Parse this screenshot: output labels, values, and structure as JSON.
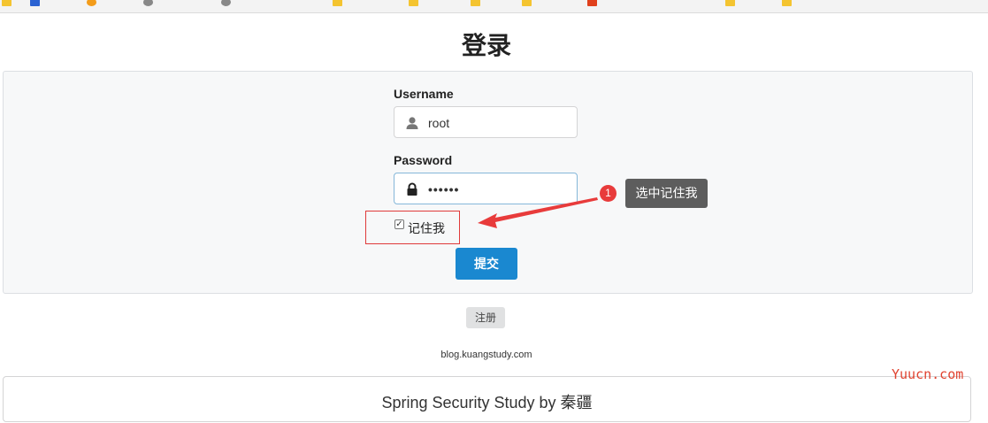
{
  "page_title": "登录",
  "form": {
    "username_label": "Username",
    "username_value": "root",
    "password_label": "Password",
    "password_value": "••••••",
    "remember_label": "记住我",
    "remember_checked": true,
    "submit_label": "提交"
  },
  "register_label": "注册",
  "blog_text": "blog.kuangstudy.com",
  "footer_text": "Spring Security Study by 秦疆",
  "annotation": {
    "step_number": "1",
    "tooltip_text": "选中记住我",
    "color": "#e83b3b"
  },
  "watermark": "Yuucn.com",
  "colors": {
    "primary": "#1a88d0",
    "panel_bg": "#f7f8f9",
    "highlight_border": "#e03a3a"
  }
}
